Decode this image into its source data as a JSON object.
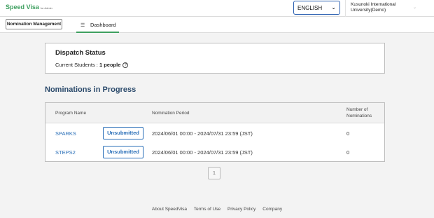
{
  "header": {
    "logo_text": "Speed Visa",
    "logo_sub": "for Admin",
    "language_selected": "ENGLISH",
    "university_name": "Kusunoki International University(Demo)"
  },
  "nav": {
    "nomination_management_label": "Nomination Management",
    "dashboard_label": "Dashboard"
  },
  "dispatch": {
    "title": "Dispatch Status",
    "students_label": "Current Students : ",
    "students_value": "1 people"
  },
  "nominations": {
    "title": "Nominations in Progress",
    "columns": {
      "program_name": "Program Name",
      "nomination_period": "Nomination Period",
      "number_of_nominations": "Number of Nominations"
    },
    "rows": [
      {
        "program": "SPARKS",
        "status": "Unsubmitted",
        "period": "2024/06/01 00:00 - 2024/07/31 23:59 (JST)",
        "count": "0"
      },
      {
        "program": "STEPS2",
        "status": "Unsubmitted",
        "period": "2024/06/01 00:00 - 2024/07/31 23:59 (JST)",
        "count": "0"
      }
    ]
  },
  "pagination": {
    "current_page": "1"
  },
  "footer": {
    "links": [
      "About SpeedVisa",
      "Terms of Use",
      "Privacy Policy",
      "Company"
    ]
  },
  "colors": {
    "brand_green": "#3fa060",
    "link_blue": "#2a6fb8",
    "section_title": "#2b4a6b"
  },
  "icons": {
    "language_dropdown": "chevron-down-icon",
    "account_menu": "chevron-down-icon",
    "dashboard": "list-icon",
    "help": "question-circle-icon"
  }
}
